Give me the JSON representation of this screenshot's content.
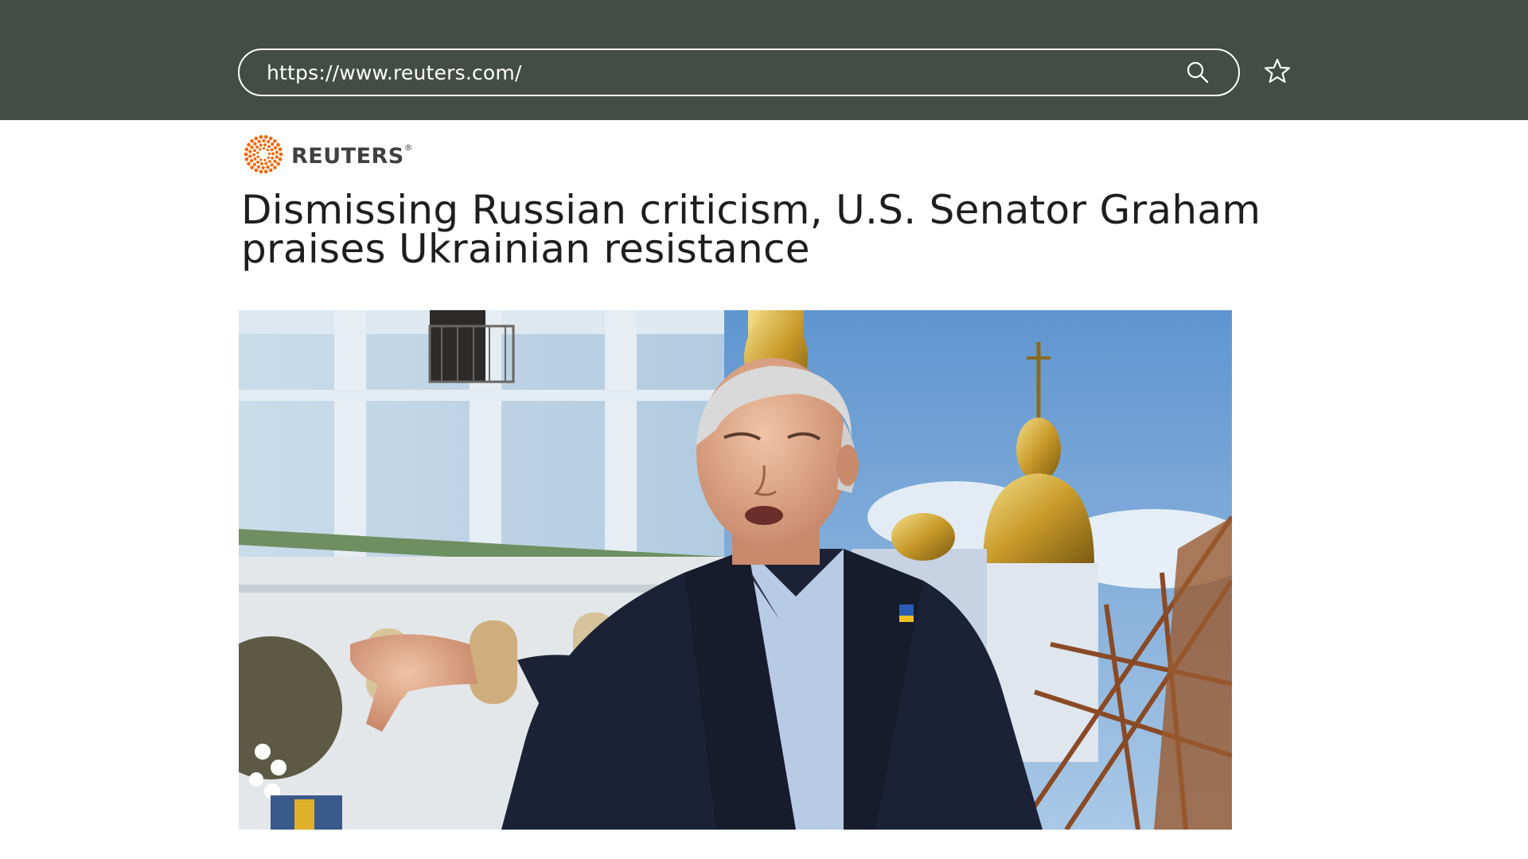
{
  "browser": {
    "url": "https://www.reuters.com/"
  },
  "site": {
    "logo_text": "REUTERS",
    "logo_mark": "®",
    "brand_color": "#fa6400"
  },
  "article": {
    "headline": "Dismissing Russian criticism, U.S. Senator Graham praises Ukrainian resistance"
  },
  "icons": {
    "search": "search-icon",
    "bookmark": "star-icon",
    "logo": "reuters-logo-icon"
  },
  "colors": {
    "chrome_background": "#444c45",
    "headline_text": "#1e1e1e"
  }
}
